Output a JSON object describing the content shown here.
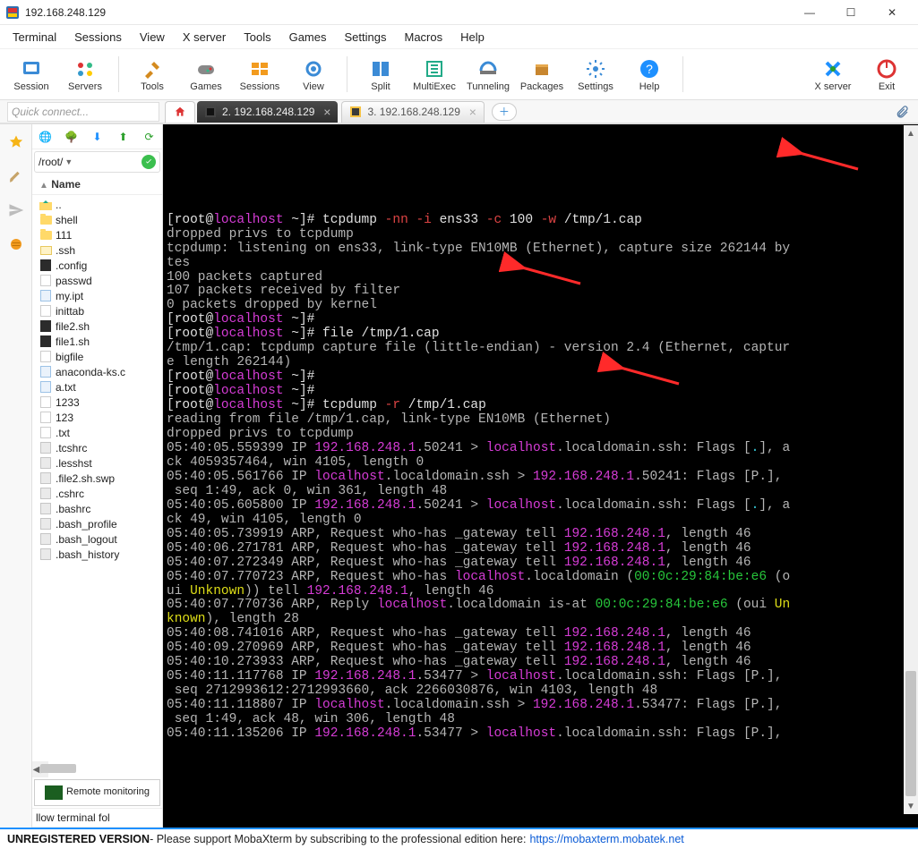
{
  "window": {
    "title": "192.168.248.129"
  },
  "menu": [
    "Terminal",
    "Sessions",
    "View",
    "X server",
    "Tools",
    "Games",
    "Settings",
    "Macros",
    "Help"
  ],
  "toolbar": [
    {
      "id": "session",
      "label": "Session"
    },
    {
      "id": "servers",
      "label": "Servers"
    },
    {
      "id": "tools",
      "label": "Tools"
    },
    {
      "id": "games",
      "label": "Games"
    },
    {
      "id": "sessions",
      "label": "Sessions"
    },
    {
      "id": "view",
      "label": "View"
    },
    {
      "id": "split",
      "label": "Split"
    },
    {
      "id": "multiexec",
      "label": "MultiExec"
    },
    {
      "id": "tunneling",
      "label": "Tunneling"
    },
    {
      "id": "packages",
      "label": "Packages"
    },
    {
      "id": "settings",
      "label": "Settings"
    },
    {
      "id": "help",
      "label": "Help"
    }
  ],
  "toolbar_right": [
    {
      "id": "xserver",
      "label": "X server"
    },
    {
      "id": "exit",
      "label": "Exit"
    }
  ],
  "quick": {
    "placeholder": "Quick connect..."
  },
  "tabs": [
    {
      "id": "home",
      "label": ""
    },
    {
      "id": "t2",
      "label": "2. 192.168.248.129",
      "active": true
    },
    {
      "id": "t3",
      "label": "3. 192.168.248.129",
      "active": false
    }
  ],
  "sidebar": {
    "path": "/root/",
    "header": "Name",
    "items": [
      {
        "name": "..",
        "type": "up"
      },
      {
        "name": "shell",
        "type": "folder"
      },
      {
        "name": "111",
        "type": "folder"
      },
      {
        "name": ".ssh",
        "type": "lfolder"
      },
      {
        "name": ".config",
        "type": "darkfile"
      },
      {
        "name": "passwd",
        "type": "txt"
      },
      {
        "name": "my.ipt",
        "type": "doc"
      },
      {
        "name": "inittab",
        "type": "txt"
      },
      {
        "name": "file2.sh",
        "type": "darkfile"
      },
      {
        "name": "file1.sh",
        "type": "darkfile"
      },
      {
        "name": "bigfile",
        "type": "txt"
      },
      {
        "name": "anaconda-ks.c",
        "type": "doc"
      },
      {
        "name": "a.txt",
        "type": "doc"
      },
      {
        "name": "1233",
        "type": "txt"
      },
      {
        "name": "123",
        "type": "txt"
      },
      {
        "name": ".txt",
        "type": "txt"
      },
      {
        "name": ".tcshrc",
        "type": "gray"
      },
      {
        "name": ".lesshst",
        "type": "gray"
      },
      {
        "name": ".file2.sh.swp",
        "type": "gray"
      },
      {
        "name": ".cshrc",
        "type": "gray"
      },
      {
        "name": ".bashrc",
        "type": "gray"
      },
      {
        "name": ".bash_profile",
        "type": "gray"
      },
      {
        "name": ".bash_logout",
        "type": "gray"
      },
      {
        "name": ".bash_history",
        "type": "gray"
      }
    ],
    "remote": "Remote monitoring",
    "follow": "llow terminal fol"
  },
  "terminal": {
    "lines": [
      {
        "segs": [
          {
            "c": "t-white",
            "t": "[root@"
          },
          {
            "c": "t-mag",
            "t": "localhost"
          },
          {
            "c": "t-white",
            "t": " ~]# tcpdump "
          },
          {
            "c": "t-red",
            "t": "-nn -i"
          },
          {
            "c": "t-white",
            "t": " ens33 "
          },
          {
            "c": "t-red",
            "t": "-c"
          },
          {
            "c": "t-white",
            "t": " 100 "
          },
          {
            "c": "t-red",
            "t": "-w"
          },
          {
            "c": "t-white",
            "t": " /tmp/1.cap"
          }
        ]
      },
      {
        "segs": [
          {
            "c": "t-gray",
            "t": "dropped privs to tcpdump"
          }
        ]
      },
      {
        "segs": [
          {
            "c": "t-gray",
            "t": "tcpdump: listening on ens33, link-type EN10MB (Ethernet), capture size 262144 by"
          }
        ]
      },
      {
        "segs": [
          {
            "c": "t-gray",
            "t": "tes"
          }
        ]
      },
      {
        "segs": [
          {
            "c": "t-gray",
            "t": "100 packets captured"
          }
        ]
      },
      {
        "segs": [
          {
            "c": "t-gray",
            "t": "107 packets received by filter"
          }
        ]
      },
      {
        "segs": [
          {
            "c": "t-gray",
            "t": "0 packets dropped by kernel"
          }
        ]
      },
      {
        "segs": [
          {
            "c": "t-white",
            "t": "[root@"
          },
          {
            "c": "t-mag",
            "t": "localhost"
          },
          {
            "c": "t-white",
            "t": " ~]#"
          }
        ]
      },
      {
        "segs": [
          {
            "c": "t-white",
            "t": "[root@"
          },
          {
            "c": "t-mag",
            "t": "localhost"
          },
          {
            "c": "t-white",
            "t": " ~]# file /tmp/1.cap"
          }
        ]
      },
      {
        "segs": [
          {
            "c": "t-gray",
            "t": "/tmp/1.cap: tcpdump capture file (little-endian) - version 2.4 (Ethernet, captur"
          }
        ]
      },
      {
        "segs": [
          {
            "c": "t-gray",
            "t": "e length 262144)"
          }
        ]
      },
      {
        "segs": [
          {
            "c": "t-white",
            "t": "[root@"
          },
          {
            "c": "t-mag",
            "t": "localhost"
          },
          {
            "c": "t-white",
            "t": " ~]#"
          }
        ]
      },
      {
        "segs": [
          {
            "c": "t-white",
            "t": "[root@"
          },
          {
            "c": "t-mag",
            "t": "localhost"
          },
          {
            "c": "t-white",
            "t": " ~]#"
          }
        ]
      },
      {
        "segs": [
          {
            "c": "t-white",
            "t": "[root@"
          },
          {
            "c": "t-mag",
            "t": "localhost"
          },
          {
            "c": "t-white",
            "t": " ~]# tcpdump "
          },
          {
            "c": "t-red",
            "t": "-r"
          },
          {
            "c": "t-white",
            "t": " /tmp/1.cap"
          }
        ]
      },
      {
        "segs": [
          {
            "c": "t-gray",
            "t": "reading from file /tmp/1.cap, link-type EN10MB (Ethernet)"
          }
        ]
      },
      {
        "segs": [
          {
            "c": "t-gray",
            "t": "dropped privs to tcpdump"
          }
        ]
      },
      {
        "segs": [
          {
            "c": "t-gray",
            "t": "05:40:05.559399 IP "
          },
          {
            "c": "t-mag",
            "t": "192.168.248.1"
          },
          {
            "c": "t-gray",
            "t": ".50241 > "
          },
          {
            "c": "t-mag",
            "t": "localhost"
          },
          {
            "c": "t-gray",
            "t": ".localdomain.ssh: Flags ["
          },
          {
            "c": "t-cyan",
            "t": "."
          },
          {
            "c": "t-gray",
            "t": "], a"
          }
        ]
      },
      {
        "segs": [
          {
            "c": "t-gray",
            "t": "ck 4059357464, win 4105, length 0"
          }
        ]
      },
      {
        "segs": [
          {
            "c": "t-gray",
            "t": "05:40:05.561766 IP "
          },
          {
            "c": "t-mag",
            "t": "localhost"
          },
          {
            "c": "t-gray",
            "t": ".localdomain.ssh > "
          },
          {
            "c": "t-mag",
            "t": "192.168.248.1"
          },
          {
            "c": "t-gray",
            "t": ".50241: Flags [P.],"
          }
        ]
      },
      {
        "segs": [
          {
            "c": "t-gray",
            "t": " seq 1:49, ack 0, win 361, length 48"
          }
        ]
      },
      {
        "segs": [
          {
            "c": "t-gray",
            "t": "05:40:05.605800 IP "
          },
          {
            "c": "t-mag",
            "t": "192.168.248.1"
          },
          {
            "c": "t-gray",
            "t": ".50241 > "
          },
          {
            "c": "t-mag",
            "t": "localhost"
          },
          {
            "c": "t-gray",
            "t": ".localdomain.ssh: Flags ["
          },
          {
            "c": "t-cyan",
            "t": "."
          },
          {
            "c": "t-gray",
            "t": "], a"
          }
        ]
      },
      {
        "segs": [
          {
            "c": "t-gray",
            "t": "ck 49, win 4105, length 0"
          }
        ]
      },
      {
        "segs": [
          {
            "c": "t-gray",
            "t": "05:40:05.739919 ARP, Request who-has _gateway tell "
          },
          {
            "c": "t-mag",
            "t": "192.168.248.1"
          },
          {
            "c": "t-gray",
            "t": ", length 46"
          }
        ]
      },
      {
        "segs": [
          {
            "c": "t-gray",
            "t": "05:40:06.271781 ARP, Request who-has _gateway tell "
          },
          {
            "c": "t-mag",
            "t": "192.168.248.1"
          },
          {
            "c": "t-gray",
            "t": ", length 46"
          }
        ]
      },
      {
        "segs": [
          {
            "c": "t-gray",
            "t": "05:40:07.272349 ARP, Request who-has _gateway tell "
          },
          {
            "c": "t-mag",
            "t": "192.168.248.1"
          },
          {
            "c": "t-gray",
            "t": ", length 46"
          }
        ]
      },
      {
        "segs": [
          {
            "c": "t-gray",
            "t": "05:40:07.770723 ARP, Request who-has "
          },
          {
            "c": "t-mag",
            "t": "localhost"
          },
          {
            "c": "t-gray",
            "t": ".localdomain ("
          },
          {
            "c": "t-green",
            "t": "00:0c:29:84:be:e6"
          },
          {
            "c": "t-gray",
            "t": " (o"
          }
        ]
      },
      {
        "segs": [
          {
            "c": "t-gray",
            "t": "ui "
          },
          {
            "c": "t-yellow",
            "t": "Unknown"
          },
          {
            "c": "t-gray",
            "t": ")) tell "
          },
          {
            "c": "t-mag",
            "t": "192.168.248.1"
          },
          {
            "c": "t-gray",
            "t": ", length 46"
          }
        ]
      },
      {
        "segs": [
          {
            "c": "t-gray",
            "t": "05:40:07.770736 ARP, Reply "
          },
          {
            "c": "t-mag",
            "t": "localhost"
          },
          {
            "c": "t-gray",
            "t": ".localdomain is-at "
          },
          {
            "c": "t-green",
            "t": "00:0c:29:84:be:e6"
          },
          {
            "c": "t-gray",
            "t": " (oui "
          },
          {
            "c": "t-yellow",
            "t": "Un"
          }
        ]
      },
      {
        "segs": [
          {
            "c": "t-yellow",
            "t": "known"
          },
          {
            "c": "t-gray",
            "t": "), length 28"
          }
        ]
      },
      {
        "segs": [
          {
            "c": "t-gray",
            "t": "05:40:08.741016 ARP, Request who-has _gateway tell "
          },
          {
            "c": "t-mag",
            "t": "192.168.248.1"
          },
          {
            "c": "t-gray",
            "t": ", length 46"
          }
        ]
      },
      {
        "segs": [
          {
            "c": "t-gray",
            "t": "05:40:09.270969 ARP, Request who-has _gateway tell "
          },
          {
            "c": "t-mag",
            "t": "192.168.248.1"
          },
          {
            "c": "t-gray",
            "t": ", length 46"
          }
        ]
      },
      {
        "segs": [
          {
            "c": "t-gray",
            "t": "05:40:10.273933 ARP, Request who-has _gateway tell "
          },
          {
            "c": "t-mag",
            "t": "192.168.248.1"
          },
          {
            "c": "t-gray",
            "t": ", length 46"
          }
        ]
      },
      {
        "segs": [
          {
            "c": "t-gray",
            "t": "05:40:11.117768 IP "
          },
          {
            "c": "t-mag",
            "t": "192.168.248.1"
          },
          {
            "c": "t-gray",
            "t": ".53477 > "
          },
          {
            "c": "t-mag",
            "t": "localhost"
          },
          {
            "c": "t-gray",
            "t": ".localdomain.ssh: Flags [P.],"
          }
        ]
      },
      {
        "segs": [
          {
            "c": "t-gray",
            "t": " seq 2712993612:2712993660, ack 2266030876, win 4103, length 48"
          }
        ]
      },
      {
        "segs": [
          {
            "c": "t-gray",
            "t": "05:40:11.118807 IP "
          },
          {
            "c": "t-mag",
            "t": "localhost"
          },
          {
            "c": "t-gray",
            "t": ".localdomain.ssh > "
          },
          {
            "c": "t-mag",
            "t": "192.168.248.1"
          },
          {
            "c": "t-gray",
            "t": ".53477: Flags [P.],"
          }
        ]
      },
      {
        "segs": [
          {
            "c": "t-gray",
            "t": " seq 1:49, ack 48, win 306, length 48"
          }
        ]
      },
      {
        "segs": [
          {
            "c": "t-gray",
            "t": "05:40:11.135206 IP "
          },
          {
            "c": "t-mag",
            "t": "192.168.248.1"
          },
          {
            "c": "t-gray",
            "t": ".53477 > "
          },
          {
            "c": "t-mag",
            "t": "localhost"
          },
          {
            "c": "t-gray",
            "t": ".localdomain.ssh: Flags [P.],"
          }
        ]
      }
    ]
  },
  "footer": {
    "unreg": "UNREGISTERED VERSION",
    "text": "   -   Please support MobaXterm by subscribing to the professional edition here:",
    "link": "https://mobaxterm.mobatek.net"
  }
}
